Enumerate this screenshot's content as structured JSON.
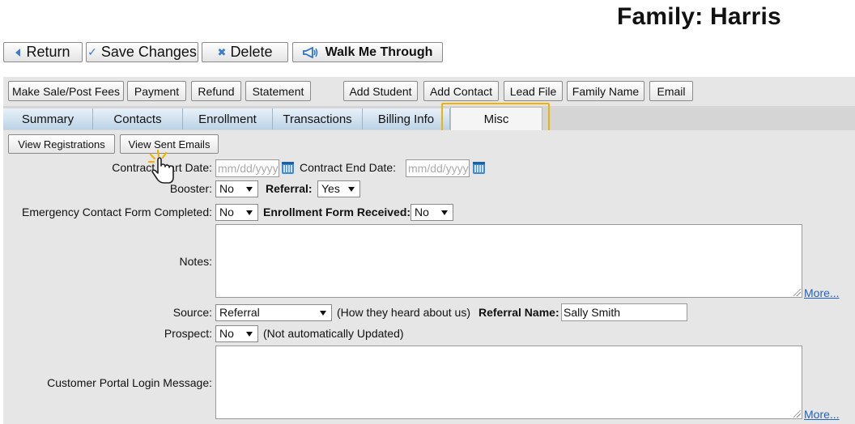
{
  "page": {
    "title": "Family: Harris"
  },
  "toolbar": {
    "return_label": "Return",
    "save_label": "Save Changes",
    "delete_label": "Delete",
    "walk_label": "Walk Me Through"
  },
  "actions": {
    "make_sale": "Make Sale/Post Fees",
    "payment": "Payment",
    "refund": "Refund",
    "statement": "Statement",
    "add_student": "Add Student",
    "add_contact": "Add Contact",
    "lead_file": "Lead File",
    "family_name": "Family Name",
    "email": "Email"
  },
  "tabs": [
    "Summary",
    "Contacts",
    "Enrollment",
    "Transactions",
    "Billing Info",
    "Misc"
  ],
  "active_tab": "Misc",
  "sub_actions": {
    "view_registrations": "View Registrations",
    "view_sent_emails": "View Sent Emails"
  },
  "form": {
    "contract_start_label": "Contract Start Date:",
    "contract_start_placeholder": "mm/dd/yyyy",
    "contract_end_label": "Contract End Date:",
    "contract_end_placeholder": "mm/dd/yyyy",
    "booster_label": "Booster:",
    "booster_value": "No",
    "referral_label": "Referral:",
    "referral_value": "Yes",
    "emergency_label": "Emergency Contact Form Completed:",
    "emergency_value": "No",
    "enrollment_form_label": "Enrollment Form Received:",
    "enrollment_form_value": "No",
    "notes_label": "Notes:",
    "more_label": "More...",
    "source_label": "Source:",
    "source_value": "Referral",
    "source_hint": "(How they heard about us)",
    "referral_name_label": "Referral Name:",
    "referral_name_value": "Sally Smith",
    "prospect_label": "Prospect:",
    "prospect_value": "No",
    "prospect_hint": "(Not automatically Updated)",
    "portal_label": "Customer Portal Login Message:",
    "portal_more_label": "More..."
  },
  "colors": {
    "highlight": "#f0b400",
    "link": "#2563b8",
    "tab": "#bcd3e6",
    "icon": "#3a7bd5"
  }
}
